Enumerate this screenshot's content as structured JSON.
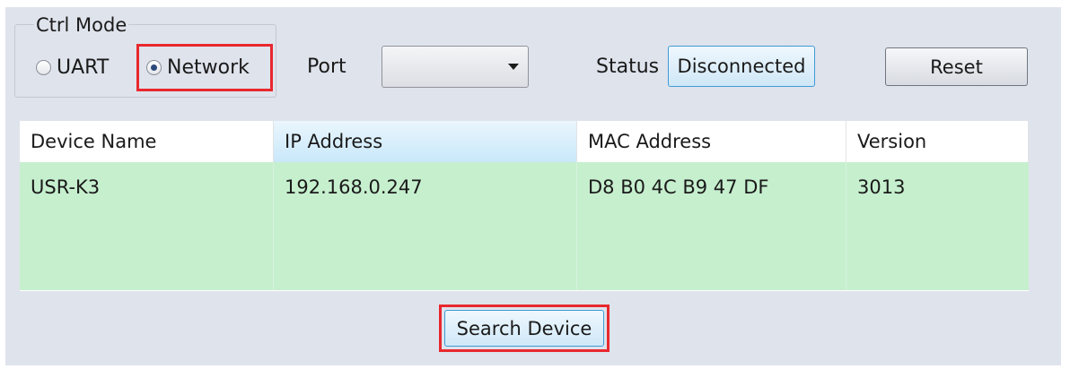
{
  "ctrl_mode": {
    "legend": "Ctrl Mode",
    "options": [
      {
        "label": "UART",
        "checked": false
      },
      {
        "label": "Network",
        "checked": true
      }
    ]
  },
  "port": {
    "label": "Port",
    "value": ""
  },
  "status": {
    "label": "Status",
    "value": "Disconnected"
  },
  "buttons": {
    "reset": "Reset",
    "search": "Search Device"
  },
  "table": {
    "columns": [
      "Device Name",
      "IP Address",
      "MAC Address",
      "Version"
    ],
    "rows": [
      [
        "USR-K3",
        "192.168.0.247",
        "D8 B0 4C B9 47 DF",
        "3013"
      ]
    ]
  },
  "colors": {
    "highlight": "#e8282e",
    "row_selected": "#c6efce",
    "panel_bg": "#dfe3ec"
  }
}
